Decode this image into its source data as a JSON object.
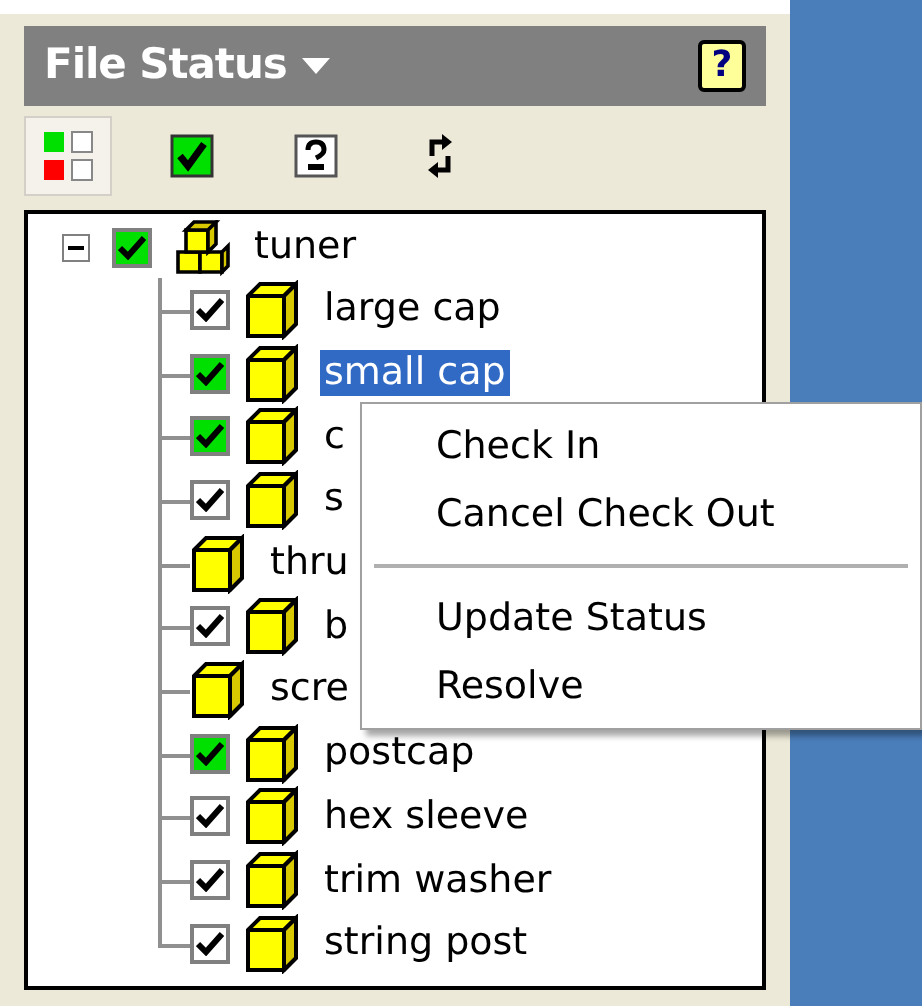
{
  "panel": {
    "title": "File Status",
    "help_button": "?"
  },
  "toolbar": [
    {
      "kind": "grid",
      "selected": true
    },
    {
      "kind": "check",
      "selected": false
    },
    {
      "kind": "unknown",
      "selected": false
    },
    {
      "kind": "refresh",
      "selected": false
    }
  ],
  "tree": {
    "label": "tuner",
    "expanded": true,
    "checked": true,
    "color": "#00e000",
    "children": [
      {
        "label": "large cap",
        "kind": "checkbox",
        "checked": true,
        "color": "#ffffff",
        "selected": false
      },
      {
        "label": "small cap",
        "kind": "checkbox",
        "checked": true,
        "color": "#00e000",
        "selected": true
      },
      {
        "label": "c",
        "kind": "checkbox",
        "checked": true,
        "color": "#00e000",
        "selected": false
      },
      {
        "label": "s",
        "kind": "checkbox",
        "checked": true,
        "color": "#ffffff",
        "selected": false
      },
      {
        "label": "thru",
        "kind": "plain",
        "selected": false
      },
      {
        "label": "b",
        "kind": "checkbox",
        "checked": true,
        "color": "#ffffff",
        "selected": false
      },
      {
        "label": "scre",
        "kind": "plain",
        "selected": false
      },
      {
        "label": "postcap",
        "kind": "checkbox",
        "checked": true,
        "color": "#00e000",
        "selected": false
      },
      {
        "label": "hex sleeve",
        "kind": "checkbox",
        "checked": true,
        "color": "#ffffff",
        "selected": false
      },
      {
        "label": "trim washer",
        "kind": "checkbox",
        "checked": true,
        "color": "#ffffff",
        "selected": false
      },
      {
        "label": "string post",
        "kind": "checkbox",
        "checked": true,
        "color": "#ffffff",
        "selected": false
      }
    ]
  },
  "context_menu": [
    {
      "kind": "item",
      "label": "Check In"
    },
    {
      "kind": "item",
      "label": "Cancel Check Out"
    },
    {
      "kind": "separator"
    },
    {
      "kind": "item",
      "label": "Update Status"
    },
    {
      "kind": "item",
      "label": "Resolve"
    }
  ]
}
